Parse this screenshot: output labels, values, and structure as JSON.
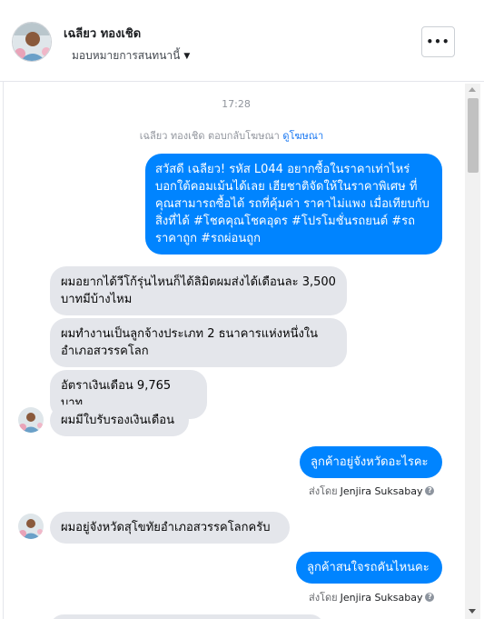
{
  "header": {
    "contact_name": "เฉลียว ทองเชิด",
    "assign_label": "มอบหมายการสนทนานี้",
    "more_label": "•••"
  },
  "conversation": {
    "timestamp": "17:28",
    "reply_note": {
      "text": "เฉลียว ทองเชิด ตอบกลับโฆษณา",
      "link": "ดูโฆษณา"
    },
    "messages": [
      {
        "direction": "out",
        "text": "สวัสดี เฉลียว! รหัส L044 อยากซื้อในราคาเท่าไหร่ บอกใต้คอมเม้นได้เลย เฮียชาติจัดให้ในราคาพิเศษ ที่คุณสามารถซื้อได้ รถที่คุ้มค่า ราคาไม่แพง เมื่อเทียบกับสิ่งที่ได้ #โชคคุณโชคอุดร #โปรโมชั่นรถยนต์ #รถราคาถูก #รถผ่อนถูก"
      },
      {
        "direction": "in",
        "text": "ผมอยากได้วีโก้รุ่นไหนก็ได้ลิมิตผมส่งได้เดือนละ 3,500 บาทมีบ้างไหม"
      },
      {
        "direction": "in",
        "text": "ผมทำงานเป็นลูกจ้างประเภท 2 ธนาคารแห่งหนึ่งในอำเภอสวรรคโลก"
      },
      {
        "direction": "in",
        "text": "อัตราเงินเดือน 9,765 บาท"
      },
      {
        "direction": "in",
        "text": "ผมมีใบรับรองเงินเดือน"
      },
      {
        "direction": "out",
        "text": "ลูกค้าอยู่จังหวัดอะไรคะ"
      },
      {
        "direction": "in",
        "text": "ผมอยู่จังหวัดสุโขทัยอำเภอสวรรคโลกครับ"
      },
      {
        "direction": "out",
        "text": "ลูกค้าสนใจรถคันไหนคะ"
      }
    ],
    "sent_by_prefix": "ส่งโดย",
    "sent_by_name": "Jenjira Suksabay",
    "info_glyph": "?"
  },
  "colors": {
    "outgoing_bubble": "#0084ff",
    "incoming_bubble": "#e4e6eb",
    "link": "#1877f2"
  },
  "icons": {
    "more": "more-horizontal-icon",
    "caret": "caret-down-icon",
    "info": "info-icon"
  }
}
